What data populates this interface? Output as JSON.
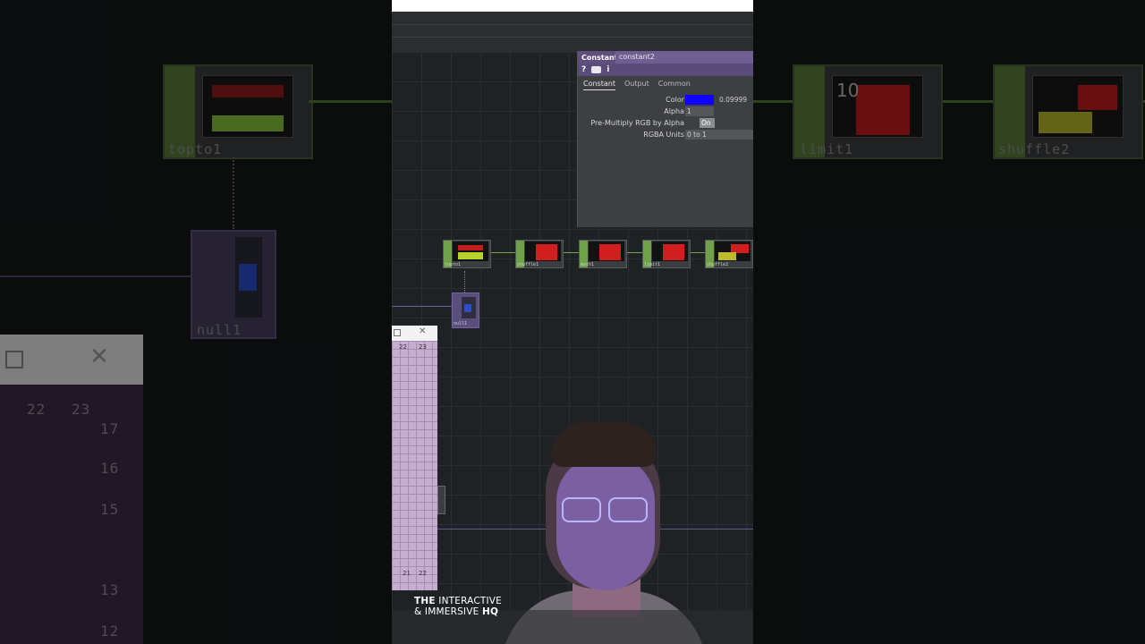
{
  "param_dialog": {
    "op_type": "Constant",
    "op_name": "constant2",
    "icons": [
      "help-icon",
      "lock-icon",
      "info-icon"
    ],
    "help_glyph": "?",
    "info_glyph": "i",
    "tabs": [
      "Constant",
      "Output",
      "Common"
    ],
    "params": {
      "color_label": "Color",
      "color_value": "0.09999",
      "color_swatch": "#0f00ff",
      "alpha_label": "Alpha",
      "alpha_value": "1",
      "premultiply_label": "Pre-Multiply RGB by Alpha",
      "premultiply_value": "On",
      "rgba_units_label": "RGBA Units",
      "rgba_units_value": "0 to 1"
    }
  },
  "network": {
    "nodes": [
      {
        "name": "topto1"
      },
      {
        "name": "shuffle1"
      },
      {
        "name": "math1"
      },
      {
        "name": "limit1"
      },
      {
        "name": "shuffle2"
      },
      {
        "name": "null1"
      }
    ]
  },
  "blurred_left": {
    "node_top": "topto1",
    "node_bottom": "null1",
    "ruler": [
      "22",
      "23",
      "17",
      "16",
      "15",
      "13",
      "12"
    ]
  },
  "blurred_right": {
    "node_a": "limit1",
    "node_b": "shuffle2"
  },
  "ruler_numbers": [
    "22",
    "23",
    "21",
    "22"
  ],
  "brand": {
    "line1_bold": "THE",
    "line1_rest": "INTERACTIVE",
    "line2_rest": "& IMMERSIVE",
    "line2_bold": "HQ"
  },
  "colors": {
    "wire": "#6ea84a",
    "op_green": "#6fa04a",
    "header_purple": "#5e4f7e",
    "node_red": "#d11f1f"
  }
}
